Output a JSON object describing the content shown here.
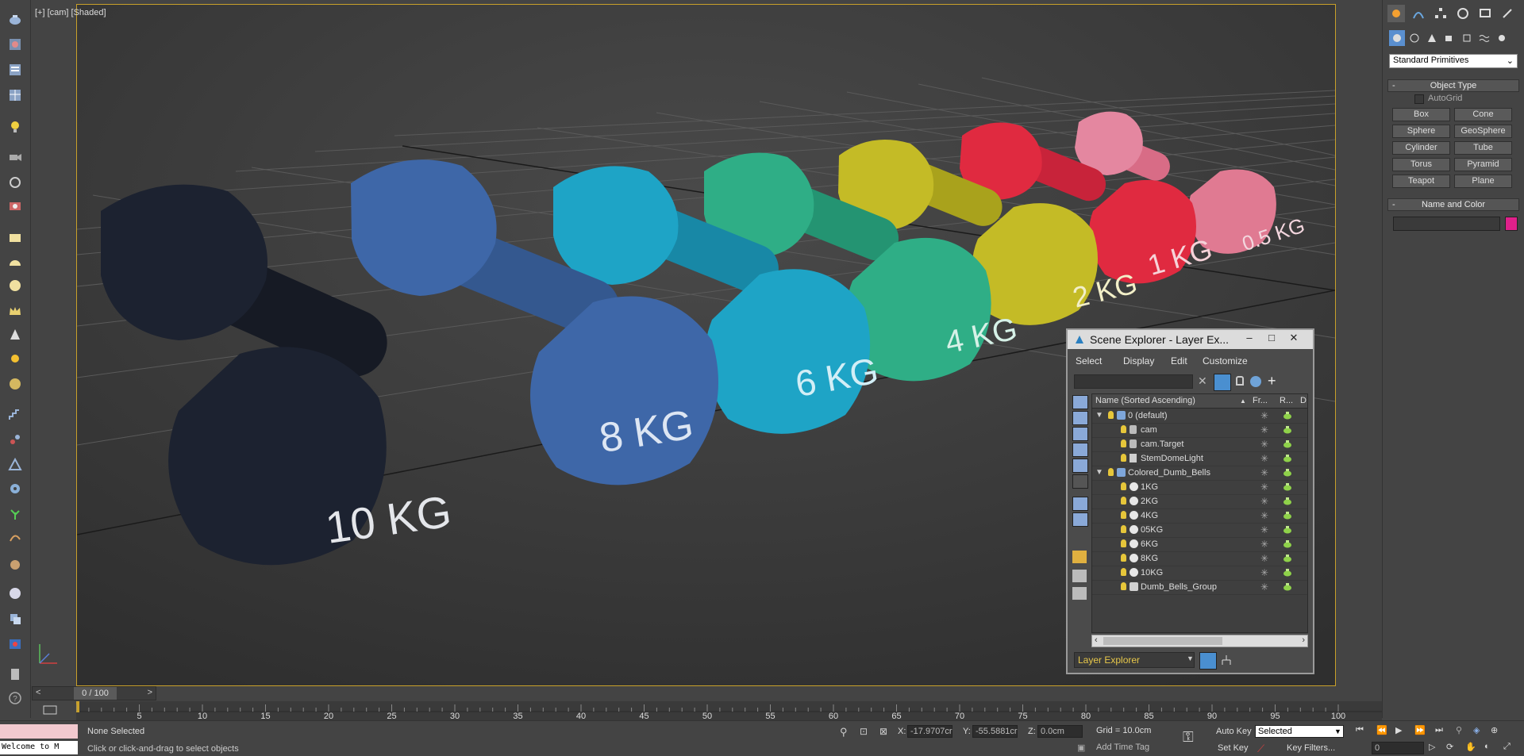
{
  "viewport": {
    "label": "[+] [cam] [Shaded]"
  },
  "dumbbells": [
    {
      "label": "10 KG",
      "color": "#1c2230"
    },
    {
      "label": "8 KG",
      "color": "#3e67a8"
    },
    {
      "label": "6 KG",
      "color": "#1ea4c6"
    },
    {
      "label": "4 KG",
      "color": "#2fae86"
    },
    {
      "label": "2 KG",
      "color": "#c4bb26"
    },
    {
      "label": "1 KG",
      "color": "#e02a40"
    },
    {
      "label": "0.5 KG",
      "color": "#e07a92"
    }
  ],
  "command_panel": {
    "dropdown": "Standard Primitives",
    "object_type": {
      "title": "Object Type",
      "autogrid": "AutoGrid",
      "buttons": [
        "Box",
        "Cone",
        "Sphere",
        "GeoSphere",
        "Cylinder",
        "Tube",
        "Torus",
        "Pyramid",
        "Teapot",
        "Plane"
      ]
    },
    "name_color": {
      "title": "Name and Color",
      "swatch": "#e0208a"
    },
    "minus": "-"
  },
  "scene_explorer": {
    "title": "Scene Explorer - Layer Ex...",
    "menus": [
      "Select",
      "Display",
      "Edit",
      "Customize"
    ],
    "columns": {
      "name": "Name (Sorted Ascending)",
      "freeze": "Fr...",
      "render": "R...",
      "d": "D"
    },
    "rows": [
      {
        "name": "0 (default)",
        "level": 0,
        "type": "layer"
      },
      {
        "name": "cam",
        "level": 1,
        "type": "camera"
      },
      {
        "name": "cam.Target",
        "level": 1,
        "type": "camera"
      },
      {
        "name": "StemDomeLight",
        "level": 1,
        "type": "light"
      },
      {
        "name": "Colored_Dumb_Bells",
        "level": 0,
        "type": "layer"
      },
      {
        "name": "1KG",
        "level": 1,
        "type": "object"
      },
      {
        "name": "2KG",
        "level": 1,
        "type": "object"
      },
      {
        "name": "4KG",
        "level": 1,
        "type": "object"
      },
      {
        "name": "05KG",
        "level": 1,
        "type": "object"
      },
      {
        "name": "6KG",
        "level": 1,
        "type": "object"
      },
      {
        "name": "8KG",
        "level": 1,
        "type": "object"
      },
      {
        "name": "10KG",
        "level": 1,
        "type": "object"
      },
      {
        "name": "Dumb_Bells_Group",
        "level": 1,
        "type": "group"
      }
    ],
    "footer_select": "Layer Explorer"
  },
  "timeline": {
    "frame": "0 / 100",
    "ticks": [
      "5",
      "10",
      "15",
      "20",
      "25",
      "30",
      "35",
      "40",
      "45",
      "50",
      "55",
      "60",
      "65",
      "70",
      "75",
      "80",
      "85",
      "90",
      "95",
      "100"
    ],
    "prev": "<",
    "next": ">"
  },
  "status": {
    "welcome": "Welcome to M",
    "selection": "None Selected",
    "prompt": "Click or click-and-drag to select objects",
    "x_label": "X:",
    "x": "-17.9707cr",
    "y_label": "Y:",
    "y": "-55.5881cr",
    "z_label": "Z:",
    "z": "0.0cm",
    "grid": "Grid = 10.0cm",
    "add_time_tag": "Add Time Tag",
    "auto_key": "Auto Key",
    "set_key": "Set Key",
    "selected": "Selected",
    "key_filters": "Key Filters...",
    "frame_field": "0"
  }
}
